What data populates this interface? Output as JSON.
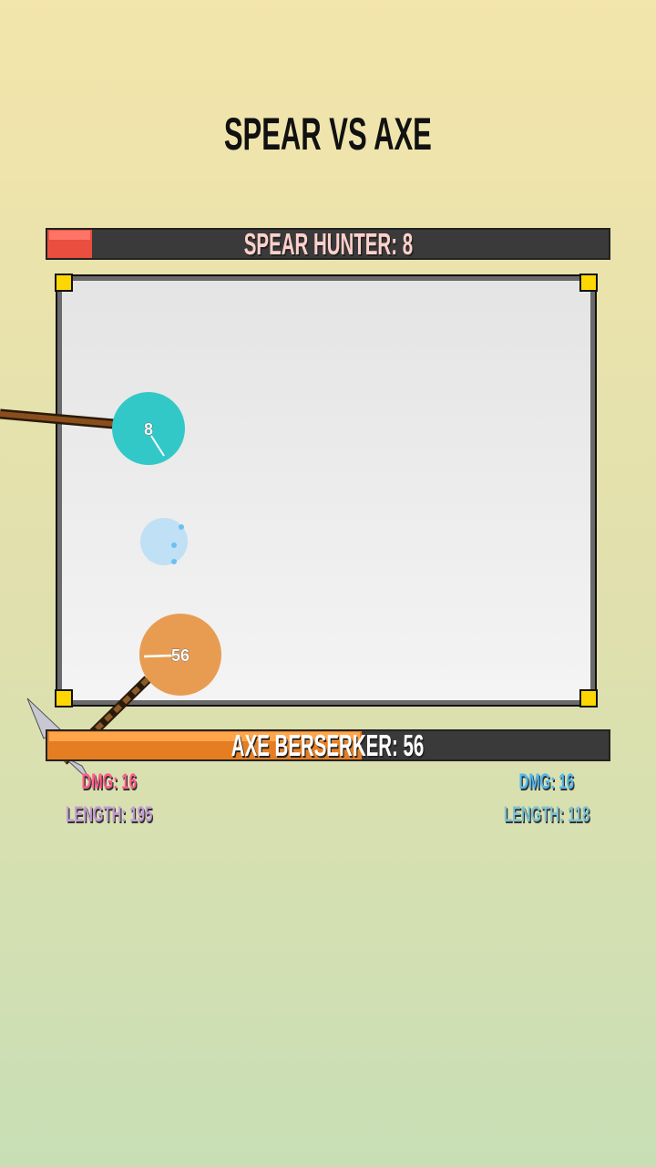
{
  "title": "SPEAR VS AXE",
  "spear": {
    "name_label": "SPEAR HUNTER: 8",
    "hp": 8,
    "max_hp": 100,
    "ball_number": "8",
    "dmg_label": "DMG: 16",
    "length_label": "LENGTH: 195",
    "ball_color": "#33c8c8",
    "bar_color": "#e94e3e"
  },
  "axe": {
    "name_label": "AXE BERSERKER: 56",
    "hp": 56,
    "max_hp": 100,
    "ball_number": "56",
    "dmg_label": "DMG: 16",
    "length_label": "LENGTH: 118",
    "ball_color": "#e89c52",
    "bar_color": "#e57e22"
  },
  "colors": {
    "spear_dmg": "#ff5c8a",
    "spear_length": "#c39bd3",
    "axe_dmg": "#4fb8f0",
    "axe_length": "#7fc3d0"
  }
}
